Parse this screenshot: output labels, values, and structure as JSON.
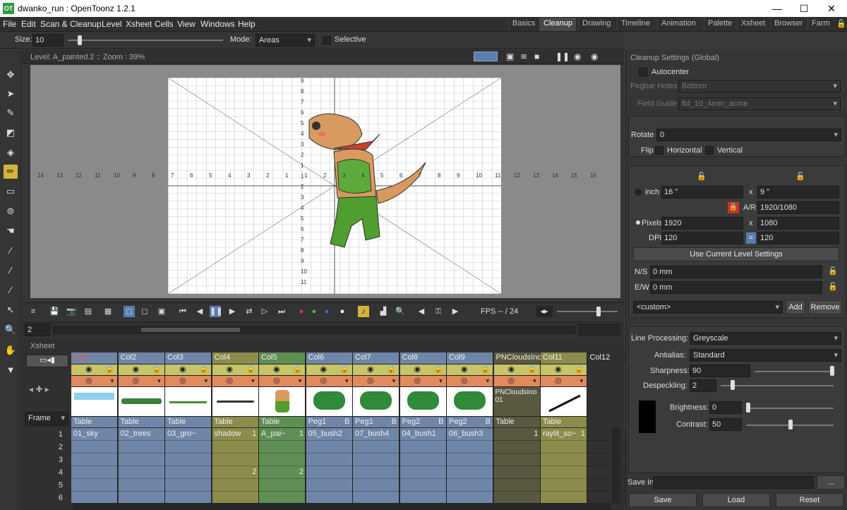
{
  "window": {
    "title": "dwanko_run : OpenToonz 1.2.1",
    "logo": "OT",
    "min": "—",
    "max": "☐",
    "close": "✕"
  },
  "menu": [
    "File",
    "Edit",
    "Scan & Cleanup",
    "Level",
    "Xsheet",
    "Cells",
    "View",
    "Windows",
    "Help"
  ],
  "rooms": [
    "Basics",
    "Cleanup",
    "Drawing",
    "Timeline",
    "Animation",
    "Palette",
    "Xsheet",
    "Browser",
    "Farm"
  ],
  "active_room": "Cleanup",
  "tool_options": {
    "size_label": "Size:",
    "size_value": "10",
    "mode_label": "Mode:",
    "mode_value": "Areas",
    "selective_label": "Selective"
  },
  "viewer": {
    "header": "Level: A_painted.2  ::  Zoom : 39%",
    "fps_label": "FPS -- / 24",
    "frame": "2"
  },
  "ruler_h": [
    "14",
    "13",
    "12",
    "11",
    "10",
    "9",
    "8",
    "7",
    "6",
    "5",
    "4",
    "3",
    "2",
    "1",
    "1",
    "2",
    "3",
    "4",
    "5",
    "6",
    "7",
    "8",
    "9",
    "10",
    "11",
    "12",
    "13",
    "14",
    "15",
    "16"
  ],
  "ruler_v": [
    "9",
    "8",
    "7",
    "6",
    "5",
    "4",
    "3",
    "2",
    "1",
    "1",
    "2",
    "3",
    "4",
    "5",
    "6",
    "7",
    "8",
    "9",
    "10",
    "11"
  ],
  "xsheet": {
    "title": "Xsheet",
    "frame_label": "Frame",
    "columns": [
      {
        "name": "Col1",
        "peg": "Table",
        "color": "#6f86a8",
        "thumb": "sky"
      },
      {
        "name": "Col2",
        "peg": "Table",
        "color": "#6f86a8",
        "thumb": "trees"
      },
      {
        "name": "Col3",
        "peg": "Table",
        "color": "#6f86a8",
        "thumb": "ground"
      },
      {
        "name": "Col4",
        "peg": "Table",
        "color": "#8c8c4c",
        "thumb": "shadow"
      },
      {
        "name": "Col5",
        "peg": "Table",
        "color": "#5f8f55",
        "thumb": "char"
      },
      {
        "name": "Col6",
        "peg": "Peg1",
        "pegb": "B",
        "color": "#6f86a8",
        "thumb": "bush"
      },
      {
        "name": "Col7",
        "peg": "Peg1",
        "pegb": "B",
        "color": "#6f86a8",
        "thumb": "bush"
      },
      {
        "name": "Col8",
        "peg": "Peg2",
        "pegb": "B",
        "color": "#6f86a8",
        "thumb": "bush"
      },
      {
        "name": "Col9",
        "peg": "Peg2",
        "pegb": "B",
        "color": "#6f86a8",
        "thumb": "bush"
      },
      {
        "name": "PNCloudsInc",
        "peg": "Table",
        "color": "#595940",
        "thumb": "pn",
        "thumb_text": "PNCloudsIno 01"
      },
      {
        "name": "Col11",
        "peg": "Table",
        "color": "#8c8c4c",
        "thumb": "line"
      },
      {
        "name": "Col12",
        "peg": "",
        "color": "#303030",
        "thumb": "none"
      }
    ],
    "rows": [
      "1",
      "2",
      "3",
      "4",
      "5",
      "6"
    ],
    "cells_row1": [
      "01_sky",
      "02_trees",
      "03_gro~",
      "shadow",
      "A_pai~",
      "05_bush2",
      "07_bush4",
      "04_bush1",
      "06_bush3",
      "",
      "raylit_so~",
      ""
    ],
    "cells_row1_num": [
      "",
      "",
      "",
      "1",
      "1",
      "",
      "",
      "",
      "",
      "1",
      "1",
      ""
    ],
    "cells_row4": [
      "",
      "",
      "",
      "2",
      "2",
      "",
      "",
      "",
      "",
      "",
      "",
      ""
    ]
  },
  "cleanup": {
    "title": "Cleanup Settings (Global)",
    "autocenter": "Autocenter",
    "pegbar_label": "Pegbar Holes",
    "pegbar_value": "Bottom",
    "fieldguide_label": "Field Guide",
    "fieldguide_value": "fld_10_4mm_acme",
    "rotate_label": "Rotate",
    "rotate_value": "0",
    "flip_label": "Flip",
    "horizontal": "Horizontal",
    "vertical": "Vertical",
    "inch_label": "inch",
    "inch_w": "16 \"",
    "inch_h": "9 \"",
    "x": "x",
    "ar_label": "A/R",
    "ar_value": "1920/1080",
    "pixels_label": "Pixels",
    "px_w": "1920",
    "px_h": "1080",
    "dpi_label": "DPI",
    "dpi_w": "120",
    "dpi_h": "120",
    "use_current": "Use Current Level Settings",
    "ns_label": "N/S",
    "ns_value": "0 mm",
    "ew_label": "E/W",
    "ew_value": "0 mm",
    "custom_value": "<custom>",
    "add": "Add",
    "remove": "Remove",
    "lineproc_label": "Line Processing:",
    "lineproc_value": "Greyscale",
    "antialias_label": "Antialias:",
    "antialias_value": "Standard",
    "sharpness_label": "Sharpness:",
    "sharpness_value": "90",
    "despeckling_label": "Despeckling:",
    "despeckling_value": "2",
    "brightness_label": "Brightness:",
    "brightness_value": "0",
    "contrast_label": "Contrast:",
    "contrast_value": "50",
    "savein_label": "Save In",
    "browse": "...",
    "save": "Save",
    "load": "Load",
    "reset": "Reset"
  }
}
